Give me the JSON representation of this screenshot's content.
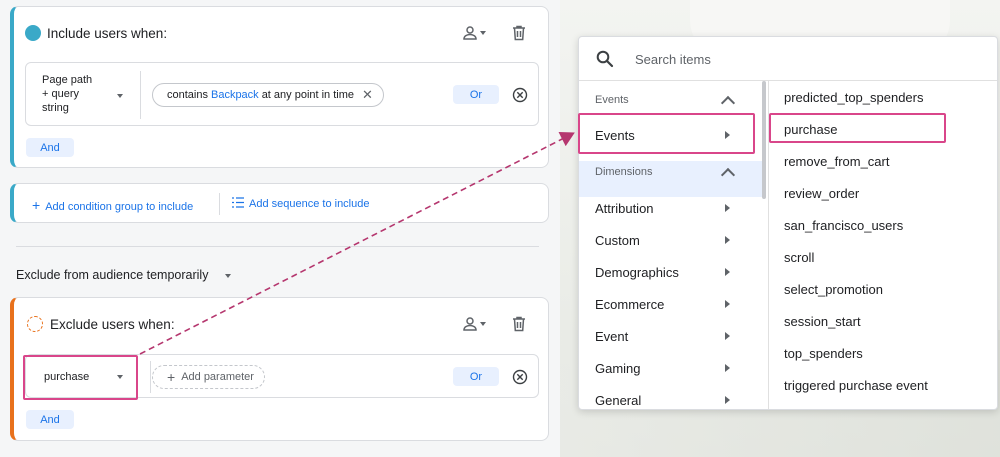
{
  "include_card": {
    "title": "Include users when:",
    "dimension": [
      "Page path",
      "+ query",
      "string"
    ],
    "condition": {
      "prefix": "contains",
      "value": "Backpack",
      "suffix": "at any point in time"
    },
    "or_label": "Or",
    "and_label": "And"
  },
  "add_links": {
    "add_group": "Add condition group to include",
    "add_sequence": "Add sequence to include"
  },
  "exclude_toggle": "Exclude from audience temporarily",
  "exclude_card": {
    "title": "Exclude users when:",
    "dimension": "purchase",
    "add_parameter": "Add parameter",
    "or_label": "Or",
    "and_label": "And"
  },
  "dropdown": {
    "search_placeholder": "Search items",
    "sections": [
      {
        "header": "Events",
        "items": [
          "Events"
        ]
      },
      {
        "header": "Dimensions",
        "items": [
          "Attribution",
          "Custom",
          "Demographics",
          "Ecommerce",
          "Event",
          "Gaming",
          "General"
        ]
      }
    ],
    "selected_category": "Events",
    "items": [
      "predicted_top_spenders",
      "purchase",
      "remove_from_cart",
      "review_order",
      "san_francisco_users",
      "scroll",
      "select_promotion",
      "session_start",
      "top_spenders",
      "triggered purchase event"
    ],
    "highlighted_item": "purchase"
  },
  "colors": {
    "include_accent": "#3aa9c8",
    "exclude_accent": "#e8711c",
    "link_blue": "#1a73e8",
    "highlight_pink": "#d9468a"
  }
}
